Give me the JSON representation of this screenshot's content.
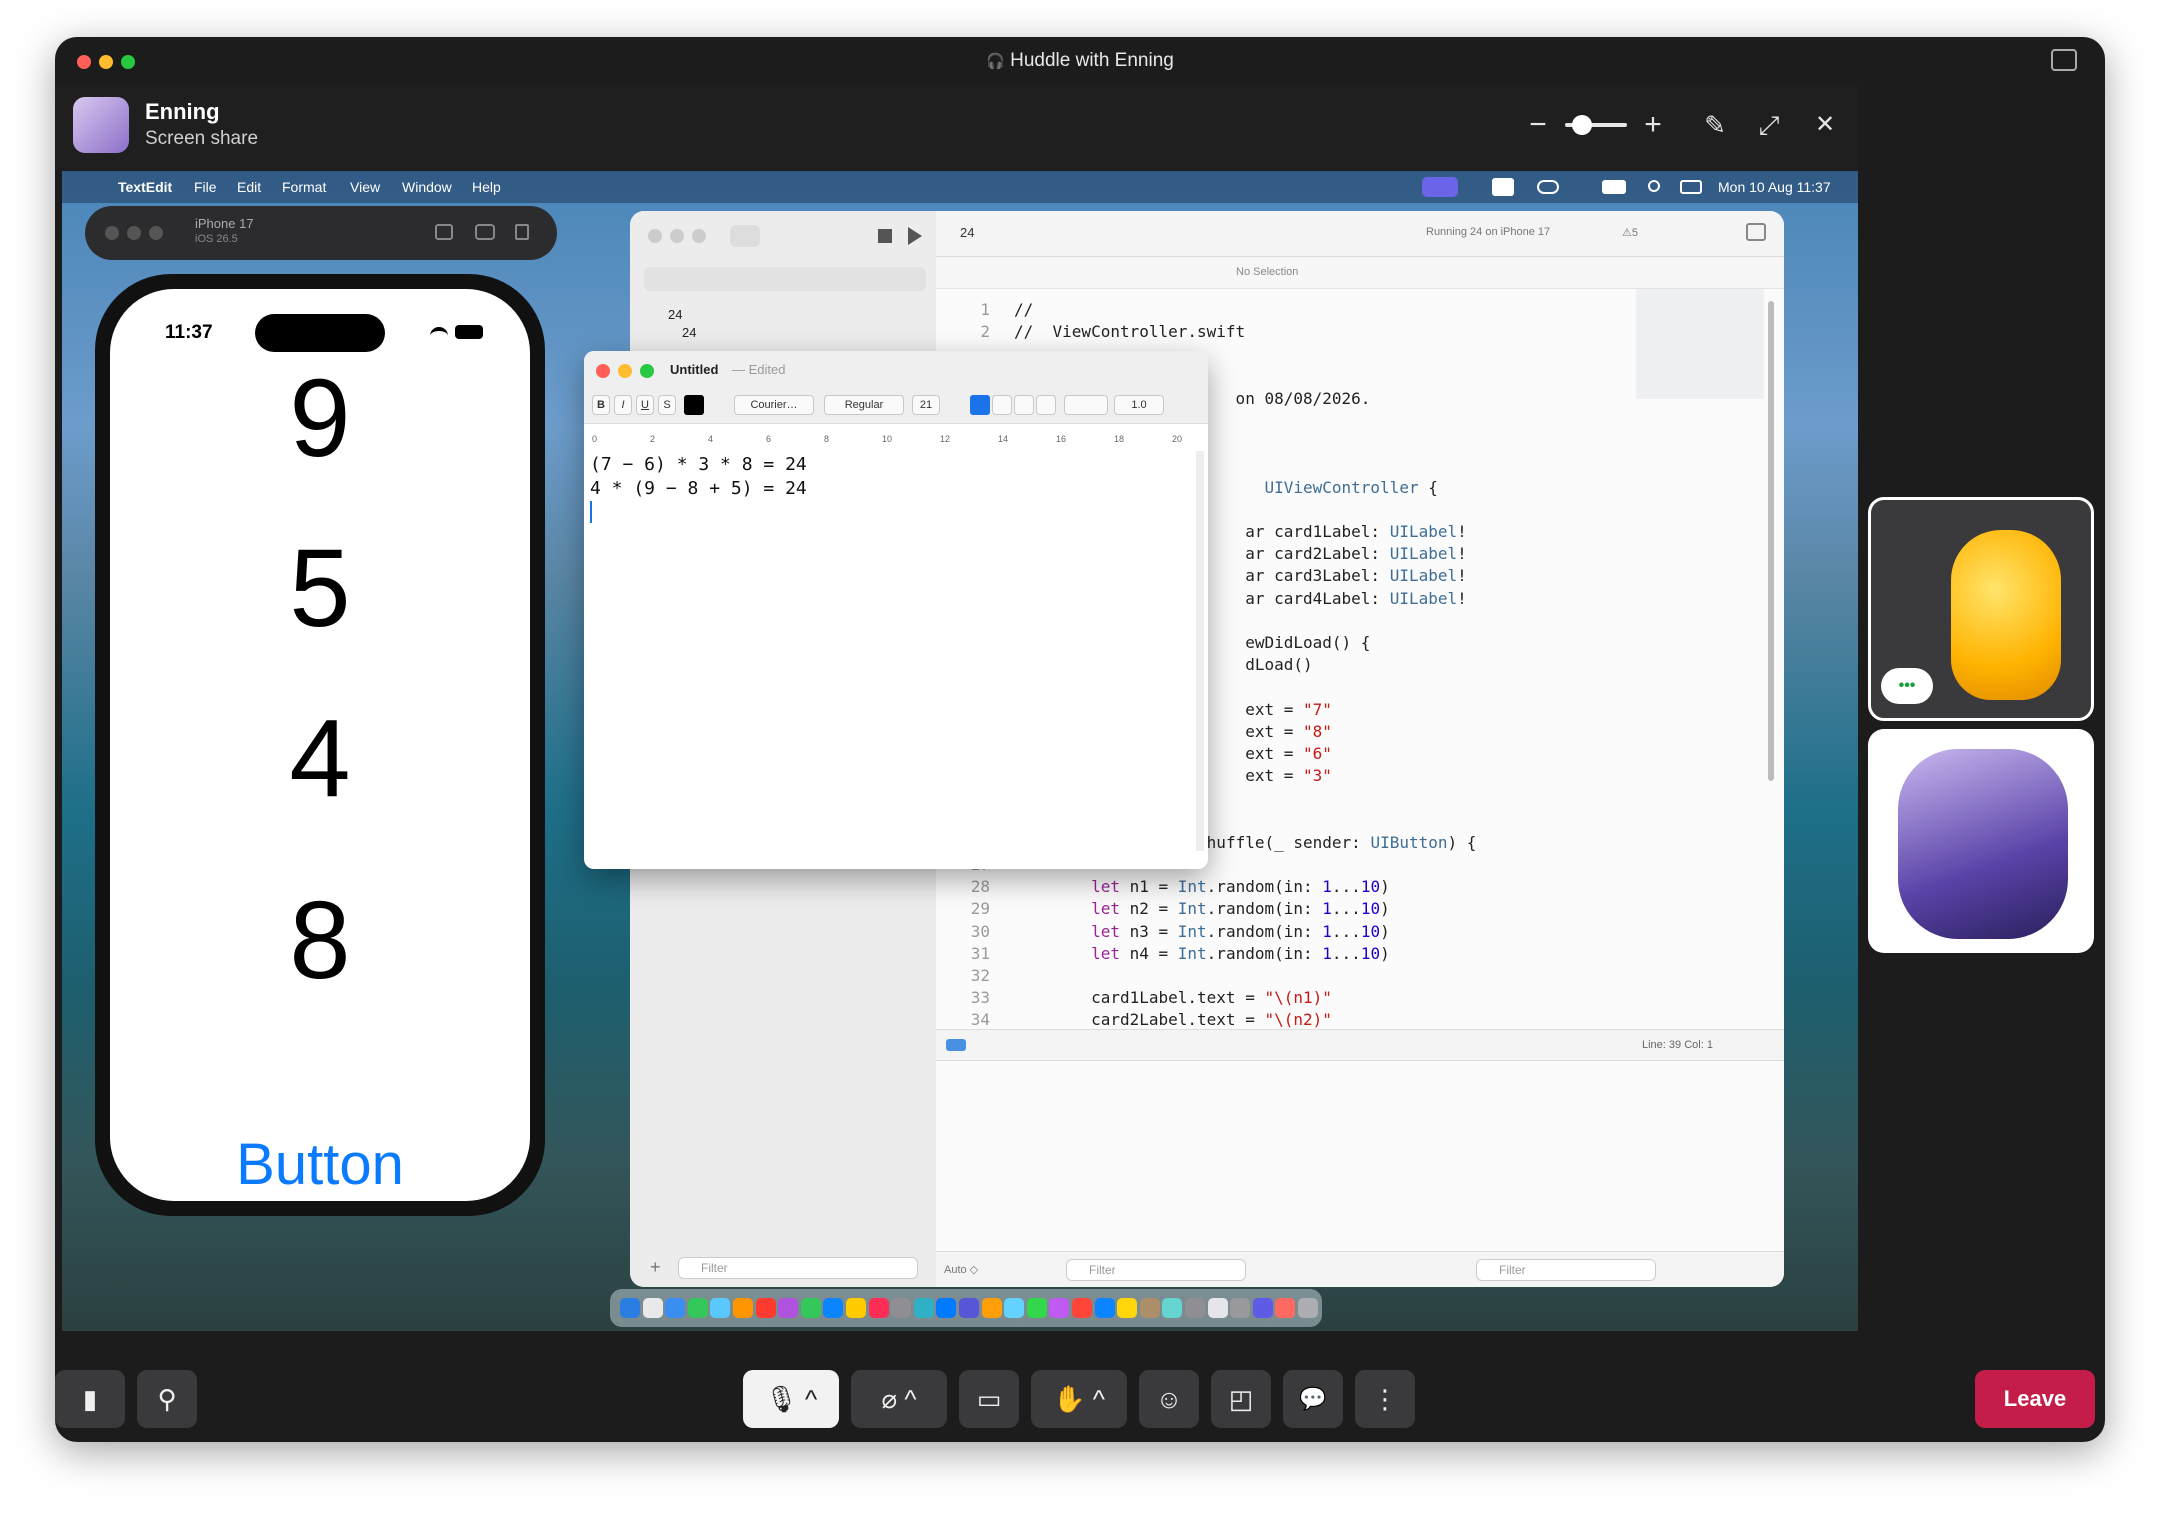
{
  "window": {
    "title": "Huddle with Enning",
    "headphone_glyph": "🎧"
  },
  "share": {
    "name": "Enning",
    "subtitle": "Screen share"
  },
  "header_controls": {
    "zoom_out": "−",
    "zoom_in": "+",
    "annotate": "✎",
    "fullscreen": "⤢",
    "close": "✕"
  },
  "mac_menu": {
    "apple": "",
    "app": "TextEdit",
    "items": [
      "File",
      "Edit",
      "Format",
      "View",
      "Window",
      "Help"
    ],
    "clock": "Mon 10 Aug  11:37"
  },
  "simulator": {
    "device": "iPhone 17",
    "os": "iOS 26.5"
  },
  "phone": {
    "time": "11:37",
    "cards": [
      "9",
      "5",
      "4",
      "8"
    ],
    "button": "Button"
  },
  "textedit": {
    "title": "Untitled",
    "status": "— Edited",
    "font": "Courier…",
    "style": "Regular",
    "size": "21",
    "spacing": "1.0",
    "format_buttons": [
      "B",
      "I",
      "U",
      "S"
    ],
    "ruler_ticks": [
      "0",
      "2",
      "4",
      "6",
      "8",
      "10",
      "12",
      "14",
      "16",
      "18",
      "20"
    ],
    "lines": [
      "(7 − 6) * 3 * 8 = 24",
      "4 * (9 − 8 + 5) = 24"
    ]
  },
  "xcode": {
    "scheme": "24",
    "run_status": "Running 24 on iPhone 17",
    "warnings": "5",
    "breadcrumb": "No Selection",
    "nav_items": [
      "24",
      "24"
    ],
    "status": "Line: 39  Col: 1",
    "auto": "Auto ◇",
    "filter_placeholder": "Filter",
    "code": [
      {
        "n": "1",
        "t": "//"
      },
      {
        "n": "2",
        "t": "//  ViewController.swift"
      },
      {
        "n": "",
        "t": ""
      },
      {
        "n": "",
        "t": ""
      },
      {
        "n": "",
        "t": "                       on 08/08/2026."
      },
      {
        "n": "",
        "t": ""
      },
      {
        "n": "",
        "t": ""
      },
      {
        "n": "",
        "t": ""
      },
      {
        "n": "",
        "t": "                          UIViewController {"
      },
      {
        "n": "",
        "t": ""
      },
      {
        "n": "",
        "t": "                        ar card1Label: UILabel!"
      },
      {
        "n": "",
        "t": "                        ar card2Label: UILabel!"
      },
      {
        "n": "",
        "t": "                        ar card3Label: UILabel!"
      },
      {
        "n": "",
        "t": "                        ar card4Label: UILabel!"
      },
      {
        "n": "",
        "t": ""
      },
      {
        "n": "",
        "t": "                        ewDidLoad() {"
      },
      {
        "n": "",
        "t": "                        dLoad()"
      },
      {
        "n": "",
        "t": ""
      },
      {
        "n": "",
        "t": "                        ext = \"7\""
      },
      {
        "n": "",
        "t": "                        ext = \"8\""
      },
      {
        "n": "",
        "t": "                        ext = \"6\""
      },
      {
        "n": "",
        "t": "                        ext = \"3\""
      },
      {
        "n": "",
        "t": ""
      },
      {
        "n": "",
        "t": ""
      },
      {
        "n": "◉",
        "t": "    @IBAction func shuffle(_ sender: UIButton) {"
      },
      {
        "n": "27",
        "t": ""
      },
      {
        "n": "28",
        "t": "        let n1 = Int.random(in: 1...10)"
      },
      {
        "n": "29",
        "t": "        let n2 = Int.random(in: 1...10)"
      },
      {
        "n": "30",
        "t": "        let n3 = Int.random(in: 1...10)"
      },
      {
        "n": "31",
        "t": "        let n4 = Int.random(in: 1...10)"
      },
      {
        "n": "32",
        "t": ""
      },
      {
        "n": "33",
        "t": "        card1Label.text = \"\\(n1)\""
      },
      {
        "n": "34",
        "t": "        card2Label.text = \"\\(n2)\""
      }
    ]
  },
  "participants": [
    {
      "name": "thumbs-up reaction",
      "indicator": "•••"
    },
    {
      "name": "avatar-tile"
    }
  ],
  "toolbar": {
    "stats": "▮",
    "add_person": "⚲",
    "mic": "🎙",
    "camera": "⌀",
    "share_screen": "▭",
    "raise_hand": "✋",
    "reactions": "☺",
    "sticker": "◰",
    "chat": "💬",
    "more": "⋮",
    "caret": "^",
    "leave": "Leave"
  },
  "colors": {
    "accent": "#0a7aff",
    "leave": "#c41d49",
    "window_bg": "#1c1c1d"
  }
}
